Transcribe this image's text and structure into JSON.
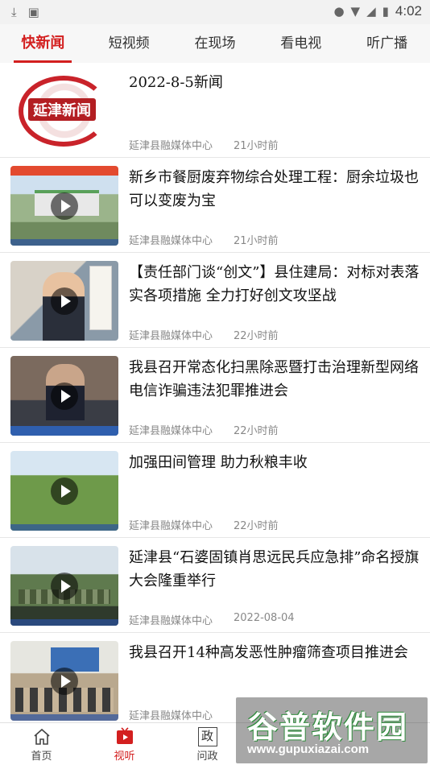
{
  "status_bar": {
    "time": "4:02",
    "icons": [
      "download-icon",
      "font-a-icon",
      "location-icon",
      "wifi-icon",
      "signal-icon",
      "battery-icon"
    ]
  },
  "tabs": [
    {
      "label": "快新闻",
      "active": true
    },
    {
      "label": "短视频",
      "active": false
    },
    {
      "label": "在现场",
      "active": false
    },
    {
      "label": "看电视",
      "active": false
    },
    {
      "label": "听广播",
      "active": false
    }
  ],
  "news": [
    {
      "title": "2022-8-5新闻",
      "source": "延津县融媒体中心",
      "time": "21小时前",
      "has_play": false
    },
    {
      "title": "新乡市餐厨废弃物综合处理工程：厨余垃圾也可以变废为宝",
      "source": "延津县融媒体中心",
      "time": "21小时前",
      "has_play": true
    },
    {
      "title": "【责任部门谈“创文”】县住建局：对标对表落实各项措施 全力打好创文攻坚战",
      "source": "延津县融媒体中心",
      "time": "22小时前",
      "has_play": true
    },
    {
      "title": "我县召开常态化扫黑除恶暨打击治理新型网络电信诈骗违法犯罪推进会",
      "source": "延津县融媒体中心",
      "time": "22小时前",
      "has_play": true
    },
    {
      "title": "加强田间管理 助力秋粮丰收",
      "source": "延津县融媒体中心",
      "time": "22小时前",
      "has_play": true
    },
    {
      "title": "延津县“石婆固镇肖思远民兵应急排”命名授旗大会隆重举行",
      "source": "延津县融媒体中心",
      "time": "2022-08-04",
      "has_play": true
    },
    {
      "title": "我县召开14种高发恶性肿瘤筛查项目推进会",
      "source": "延津县融媒体中心",
      "time": "",
      "has_play": true
    }
  ],
  "bottom_nav": [
    {
      "label": "首页",
      "icon": "home-icon",
      "active": false
    },
    {
      "label": "视听",
      "icon": "video-icon",
      "active": true
    },
    {
      "label": "问政",
      "icon": "zheng-icon",
      "active": false,
      "glyph": "政"
    }
  ],
  "watermark": {
    "text": "谷普软件园",
    "url": "www.gupuxiazai.com"
  },
  "colors": {
    "accent": "#d31f1f",
    "meta_text": "#888888"
  }
}
